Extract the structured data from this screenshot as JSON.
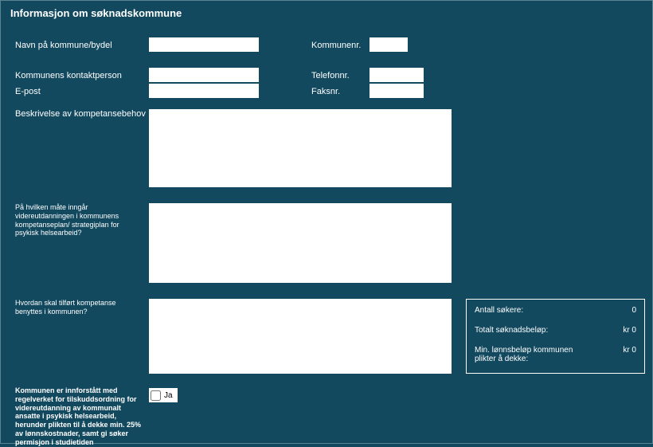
{
  "title": "Informasjon om søknadskommune",
  "fields": {
    "navn_label": "Navn på kommune/bydel",
    "navn_value": "",
    "kommunenr_label": "Kommunenr.",
    "kommunenr_value": "",
    "kontakt_label": "Kommunens kontaktperson",
    "kontakt_value": "",
    "telefon_label": "Telefonnr.",
    "telefon_value": "",
    "epost_label": "E-post",
    "epost_value": "",
    "faks_label": "Faksnr.",
    "faks_value": "",
    "beskrivelse_label": "Beskrivelse av kompetansebehov",
    "beskrivelse_value": "",
    "plan_label": "På hvilken måte inngår videreutdanningen i kommunens kompetanseplan/ strategiplan for psykisk helsearbeid?",
    "plan_value": "",
    "benyttes_label": "Hvordan skal tilført kompetanse benyttes i kommunen?",
    "benyttes_value": "",
    "regelverk_label": "Kommunen er innforstått med regelverket for tilskuddsordning for videreutdanning av kommunalt ansatte i psykisk helsearbeid, herunder plikten til å dekke min. 25% av lønnskostnader, samt gi søker permisjon i studietiden",
    "ja_label": "Ja",
    "ja_checked": false
  },
  "summary": {
    "sokere_label": "Antall søkere:",
    "sokere_value": "0",
    "totalt_label": "Totalt søknadsbeløp:",
    "totalt_value": "kr 0",
    "min_label": "Min. lønnsbeløp kommunen plikter å dekke:",
    "min_value": "kr 0"
  }
}
